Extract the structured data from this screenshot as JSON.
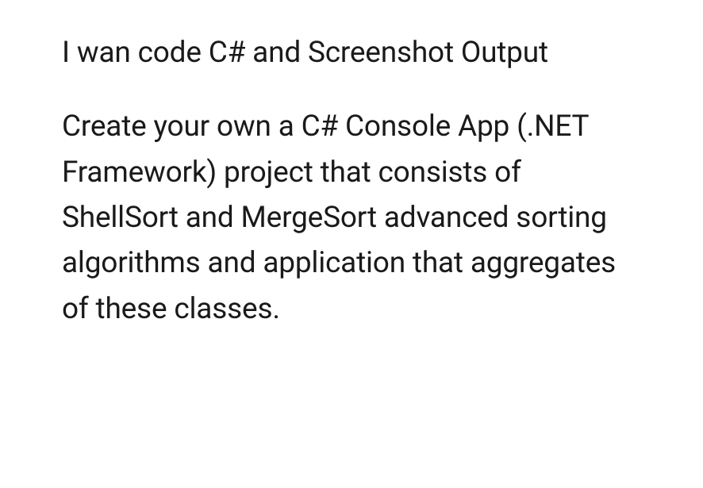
{
  "paragraphs": {
    "p1": "I wan code C# and Screenshot Output",
    "p2": "Create your own a C# Console App (.NET Framework) project that consists of ShellSort and MergeSort advanced sorting algorithms and application that aggregates of these classes."
  }
}
